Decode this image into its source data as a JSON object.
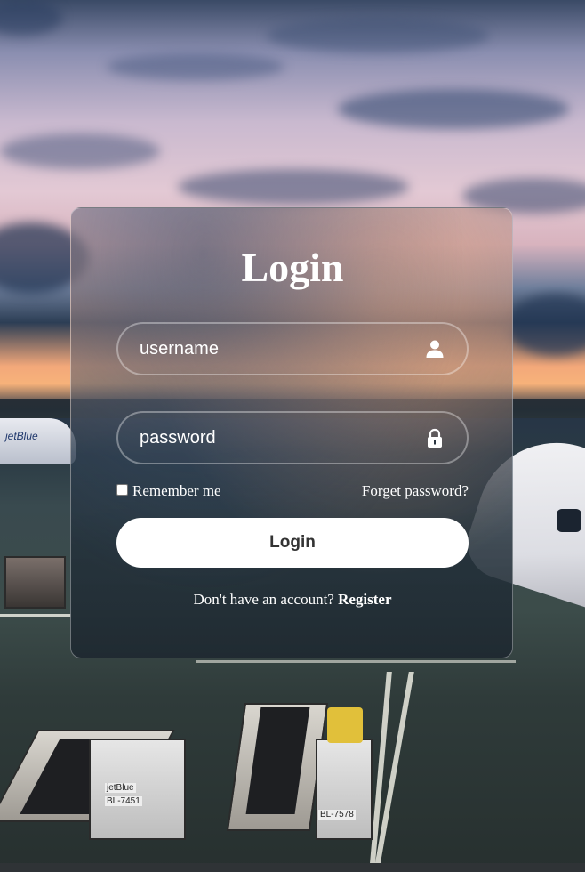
{
  "login": {
    "title": "Login",
    "username_placeholder": "username",
    "password_placeholder": "password",
    "remember_label": "Remember me",
    "forget_label": "Forget password?",
    "button_label": "Login",
    "no_account_text": "Don't have an account?",
    "register_label": "Register"
  },
  "icons": {
    "username": "user-icon",
    "password": "lock-icon"
  },
  "colors": {
    "text": "#ffffff",
    "button_bg": "#ffffff",
    "button_text": "#333333"
  },
  "background": {
    "aircraft_texts": [
      "jetBlue",
      "BL-7451",
      "BL-7578"
    ]
  }
}
